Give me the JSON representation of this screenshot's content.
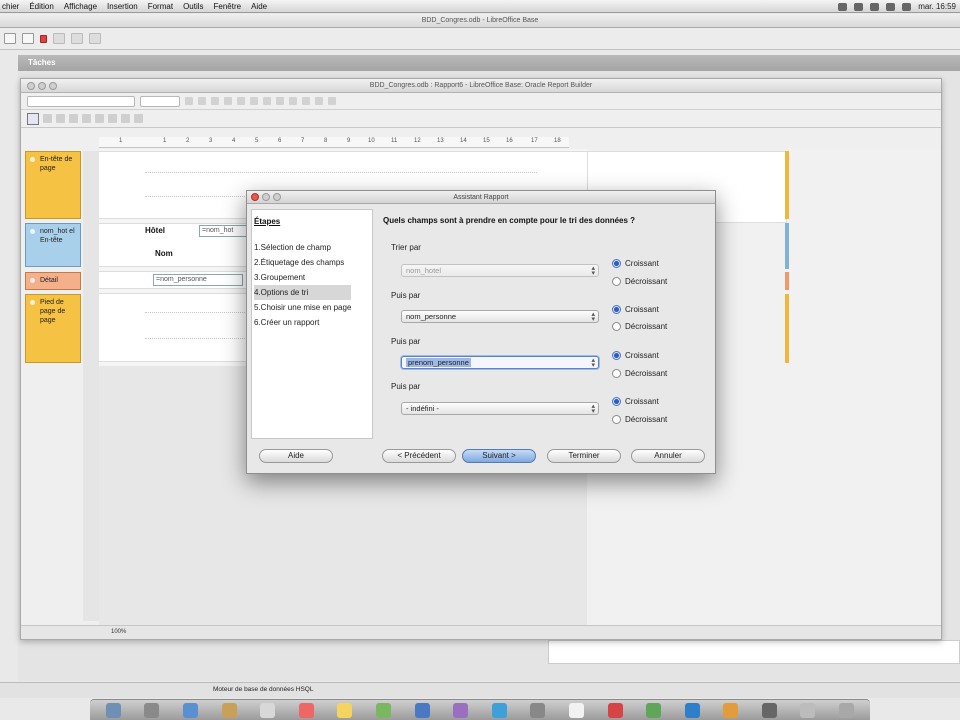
{
  "menubar": {
    "items": [
      "chier",
      "Édition",
      "Affichage",
      "Insertion",
      "Format",
      "Outils",
      "Fenêtre",
      "Aide"
    ],
    "clock": "mar. 16:59"
  },
  "base_window": {
    "title": "BDD_Congres.odb - LibreOffice Base",
    "tasks_header": "Tâches",
    "status_text": "Moteur de base de données HSQL"
  },
  "report_builder": {
    "title": "BDD_Congres.odb : Rapport6 - LibreOffice Base: Oracle Report Builder",
    "ruler_marks": [
      "1",
      "1",
      "2",
      "3",
      "4",
      "5",
      "6",
      "7",
      "8",
      "9",
      "10",
      "11",
      "12",
      "13",
      "14",
      "15",
      "16",
      "17",
      "18"
    ],
    "sections": {
      "page_header": "En-tête de page",
      "group_header": "nom_hot el En-tête",
      "detail": "Détail",
      "page_footer": "Pied de page de page"
    },
    "fields": {
      "hotel_label": "Hôtel",
      "hotel_value": "=nom_hot",
      "nom_label": "Nom",
      "nom_value": "=nom_personne"
    },
    "zoom": "100%"
  },
  "dialog": {
    "title": "Assistant Rapport",
    "steps_header": "Étapes",
    "steps": [
      "1.Sélection de champ",
      "2.Étiquetage des champs",
      "3.Groupement",
      "4.Options de tri",
      "5.Choisir une mise en page",
      "6.Créer un rapport"
    ],
    "active_step": 3,
    "question": "Quels champs sont à prendre en compte pour le tri des données ?",
    "sort_groups": [
      {
        "label": "Trier par",
        "value": "nom_hotel",
        "state": "disabled",
        "order": "Croissant"
      },
      {
        "label": "Puis par",
        "value": "nom_personne",
        "state": "normal",
        "order": "Croissant"
      },
      {
        "label": "Puis par",
        "value": "prenom_personne",
        "state": "focused",
        "order": "Croissant"
      },
      {
        "label": "Puis par",
        "value": "- indéfini -",
        "state": "normal",
        "order": "Croissant"
      }
    ],
    "ascending_label": "Croissant",
    "descending_label": "Décroissant",
    "buttons": {
      "help": "Aide",
      "back": "< Précédent",
      "next": "Suivant >",
      "finish": "Terminer",
      "cancel": "Annuler"
    }
  },
  "colors": {
    "section_yellow": "#f6c243",
    "section_blue": "#a9d0ea",
    "section_orange": "#f3b08a",
    "primary_button": "#7fa9e1",
    "radio_selected": "#2a5ec8"
  }
}
